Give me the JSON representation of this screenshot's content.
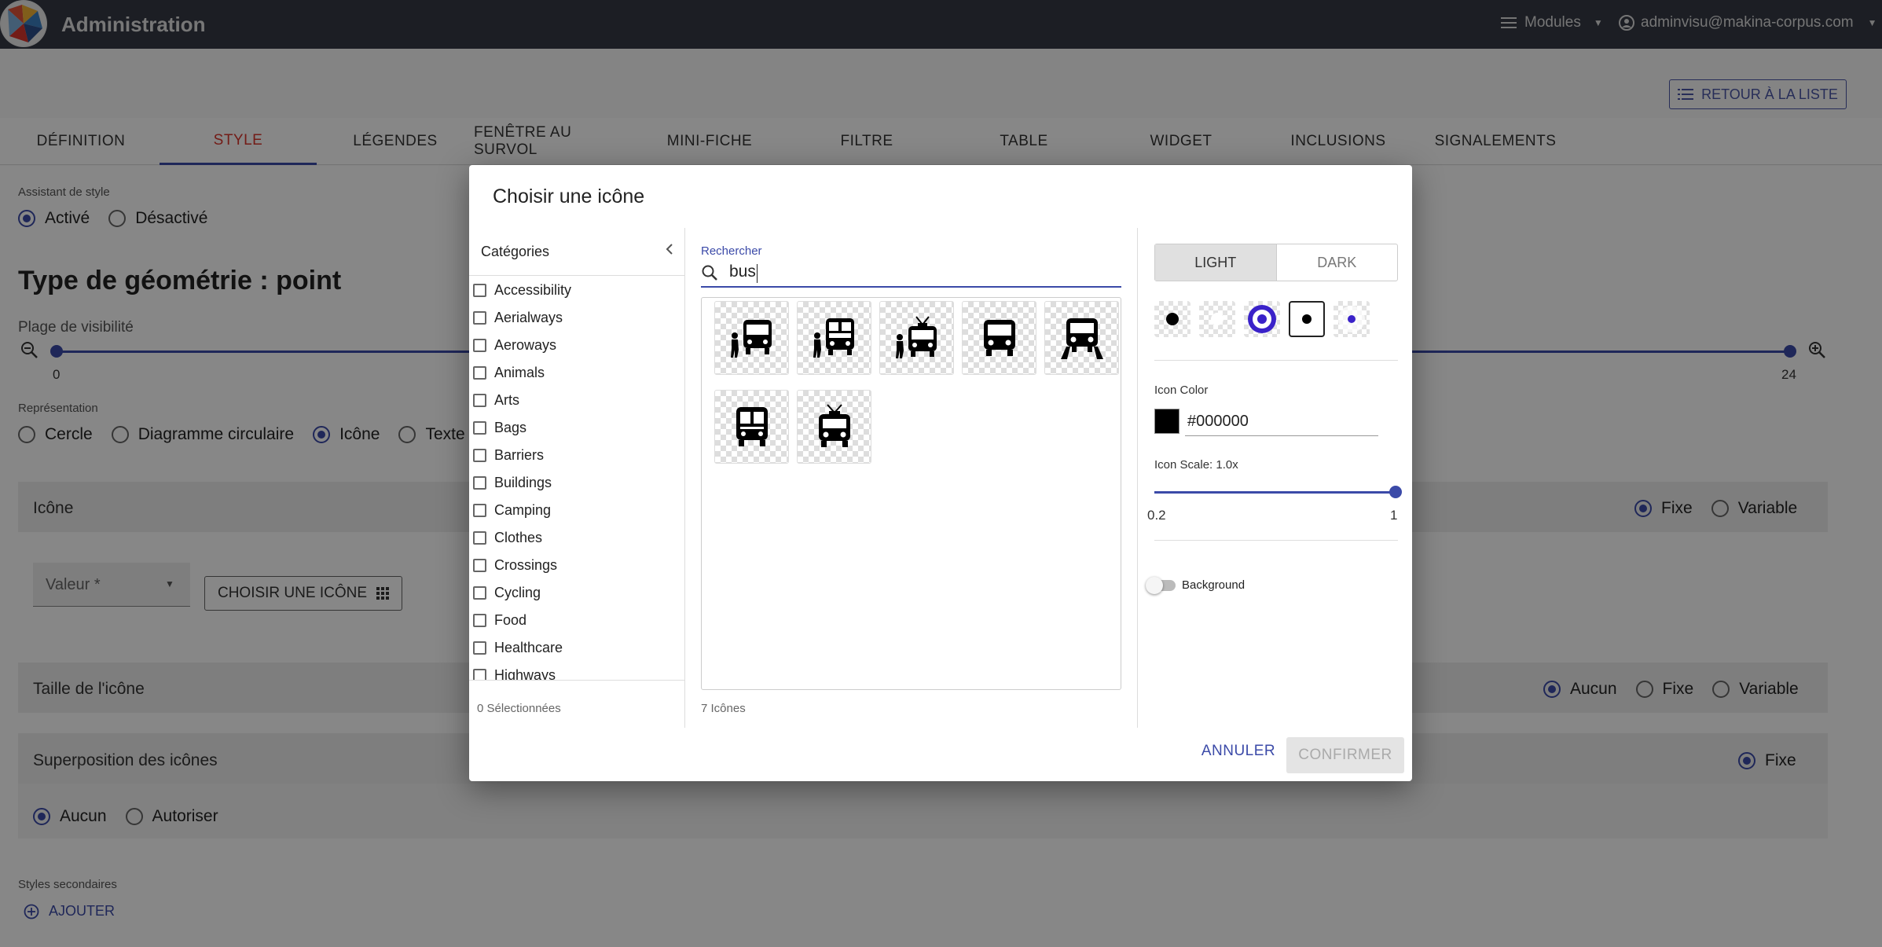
{
  "header": {
    "app_title": "Administration",
    "modules_label": "Modules",
    "user_email": "adminvisu@makina-corpus.com"
  },
  "back_button": "RETOUR À LA LISTE",
  "tabs": [
    "DÉFINITION",
    "STYLE",
    "LÉGENDES",
    "FENÊTRE AU SURVOL",
    "MINI-FICHE",
    "FILTRE",
    "TABLE",
    "WIDGET",
    "INCLUSIONS",
    "SIGNALEMENTS"
  ],
  "active_tab": "STYLE",
  "page": {
    "style_assistant_label": "Assistant de style",
    "style_assistant_on": "Activé",
    "style_assistant_off": "Désactivé",
    "geometry_title": "Type de géométrie : point",
    "visibility_label": "Plage de visibilité",
    "visibility_min": "0",
    "visibility_max": "24",
    "representation_label": "Représentation",
    "rep_circle": "Cercle",
    "rep_pie": "Diagramme circulaire",
    "rep_icon": "Icône",
    "rep_text": "Texte",
    "icon_section": "Icône",
    "fixed": "Fixe",
    "variable": "Variable",
    "value_placeholder": "Valeur *",
    "choose_icon_btn": "CHOISIR UNE ICÔNE",
    "icon_size_section": "Taille de l'icône",
    "none": "Aucun",
    "overlap_section": "Superposition des icônes",
    "allow": "Autoriser",
    "secondary_styles_label": "Styles secondaires",
    "add_label": "AJOUTER"
  },
  "dialog": {
    "title": "Choisir une icône",
    "categories_header": "Catégories",
    "categories": [
      "Accessibility",
      "Aerialways",
      "Aeroways",
      "Animals",
      "Arts",
      "Bags",
      "Barriers",
      "Buildings",
      "Camping",
      "Clothes",
      "Crossings",
      "Cycling",
      "Food",
      "Healthcare",
      "Highways"
    ],
    "selected_count": "0 Sélectionnées",
    "search_label": "Rechercher",
    "search_value": "bus",
    "icons": [
      "bus-stop-person-icon",
      "bus-stop-person-double-icon",
      "trolleybus-stop-person-icon",
      "bus-front-icon",
      "bus-station-icon",
      "bus-rear-icon",
      "trolleybus-icon"
    ],
    "icons_count": "7 Icônes",
    "theme_light": "LIGHT",
    "theme_dark": "DARK",
    "icon_color_label": "Icon Color",
    "icon_color_value": "#000000",
    "icon_scale_label": "Icon Scale: 1.0x",
    "scale_min": "0.2",
    "scale_max": "1",
    "scale_value": 1.0,
    "background_label": "Background",
    "cancel": "ANNULER",
    "confirm": "CONFIRMER"
  },
  "colors": {
    "primary": "#3b4aa8",
    "active_tab_text": "#d9362c",
    "topbar": "#353a45",
    "style_accent": "#3a22c9"
  }
}
